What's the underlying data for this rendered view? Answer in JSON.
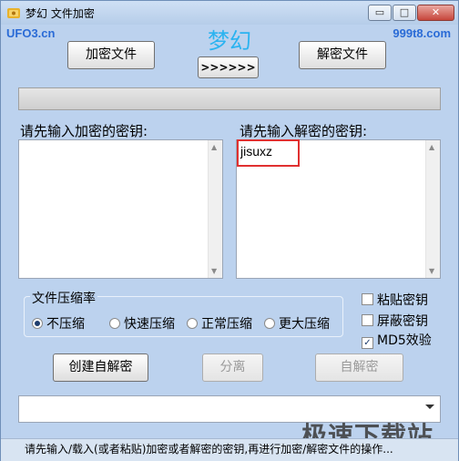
{
  "window": {
    "title": "梦幻 文件加密",
    "controls": {
      "minimize": "▭",
      "maximize": "□",
      "close": "✕"
    }
  },
  "branding": {
    "left": "UFO3.cn",
    "right": "999t8.com",
    "center": "梦幻",
    "watermark": "极速下载站"
  },
  "toolbar": {
    "encrypt_file": "加密文件",
    "arrows": ">>>>>>",
    "decrypt_file": "解密文件"
  },
  "progress": {
    "value": 0
  },
  "encrypt_key": {
    "label": "请先输入加密的密钥:",
    "value": ""
  },
  "decrypt_key": {
    "label": "请先输入解密的密钥:",
    "value": "jisuxz"
  },
  "compression": {
    "title": "文件压缩率",
    "options": [
      "不压缩",
      "快速压缩",
      "正常压缩",
      "更大压缩"
    ],
    "selected": "不压缩"
  },
  "checkboxes": {
    "paste_key": {
      "label": "粘贴密钥",
      "checked": false
    },
    "hide_key": {
      "label": "屏蔽密钥",
      "checked": false
    },
    "md5": {
      "label": "MD5效验",
      "checked": true
    }
  },
  "actions": {
    "create_self_decrypt": "创建自解密",
    "separate": "分离",
    "self_decrypt": "自解密"
  },
  "status": {
    "text": "请先输入/载入(或者粘贴)加密或者解密的密钥,再进行加密/解密文件的操作..."
  },
  "colors": {
    "window_bg": "#bcd2ee",
    "brand": "#2a6bd6",
    "center_title": "#2bb3f0",
    "highlight": "#e03030"
  }
}
